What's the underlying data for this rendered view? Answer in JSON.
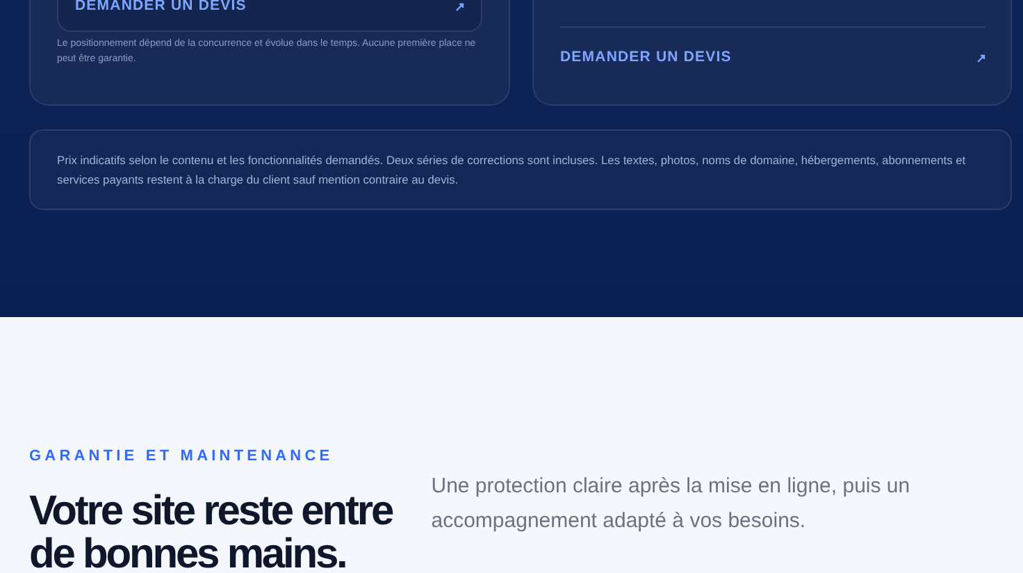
{
  "offers": [
    {
      "kind": "boxed",
      "cta": "DEMANDER UN DEVIS",
      "note": "Le positionnement dépend de la concurrence et évolue dans le temps. Aucune première place ne peut être garantie."
    },
    {
      "kind": "divided",
      "cta": "DEMANDER UN DEVIS"
    }
  ],
  "pricing_note": "Prix indicatifs selon le contenu et les fonctionnalités demandés. Deux séries de corrections sont incluses. Les textes, photos, noms de domaine, hébergements, abonnements et services payants restent à la charge du client sauf mention contraire au devis.",
  "guarantee": {
    "eyebrow": "GARANTIE ET MAINTENANCE",
    "heading": "Votre site reste entre de bonnes mains.",
    "intro": "Une protection claire après la mise en ligne, puis un accompagnement adapté à vos besoins."
  }
}
